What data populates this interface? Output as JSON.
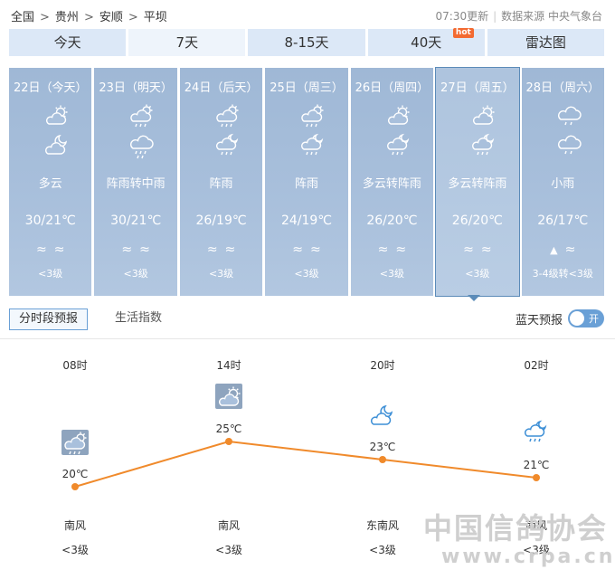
{
  "breadcrumb": {
    "items": [
      "全国",
      "贵州",
      "安顺",
      "平坝"
    ],
    "sep": ">"
  },
  "header": {
    "updated": "07:30更新",
    "source": "数据来源 中央气象台"
  },
  "tabs": [
    {
      "label": "今天"
    },
    {
      "label": "7天",
      "active": true
    },
    {
      "label": "8-15天"
    },
    {
      "label": "40天",
      "badge": "hot"
    },
    {
      "label": "雷达图"
    }
  ],
  "days": [
    {
      "date": "22日（今天）",
      "icon_day": "partly-cloudy-day-icon",
      "icon_night": "partly-cloudy-night-icon",
      "desc": "多云",
      "temp": "30/21℃",
      "wind_icon1": "≈",
      "wind_icon2": "≈",
      "wind_level": "<3级"
    },
    {
      "date": "23日（明天）",
      "icon_day": "shower-icon",
      "icon_night": "rain-icon",
      "desc": "阵雨转中雨",
      "temp": "30/21℃",
      "wind_icon1": "≈",
      "wind_icon2": "≈",
      "wind_level": "<3级"
    },
    {
      "date": "24日（后天）",
      "icon_day": "shower-icon",
      "icon_night": "shower-night-icon",
      "desc": "阵雨",
      "temp": "26/19℃",
      "wind_icon1": "≈",
      "wind_icon2": "≈",
      "wind_level": "<3级"
    },
    {
      "date": "25日（周三）",
      "icon_day": "shower-icon",
      "icon_night": "shower-night-icon",
      "desc": "阵雨",
      "temp": "24/19℃",
      "wind_icon1": "≈",
      "wind_icon2": "≈",
      "wind_level": "<3级"
    },
    {
      "date": "26日（周四）",
      "icon_day": "partly-cloudy-day-icon",
      "icon_night": "shower-night-icon",
      "desc": "多云转阵雨",
      "temp": "26/20℃",
      "wind_icon1": "≈",
      "wind_icon2": "≈",
      "wind_level": "<3级"
    },
    {
      "date": "27日（周五）",
      "icon_day": "partly-cloudy-day-icon",
      "icon_night": "shower-night-icon",
      "desc": "多云转阵雨",
      "temp": "26/20℃",
      "wind_icon1": "≈",
      "wind_icon2": "≈",
      "wind_level": "<3级",
      "selected": true
    },
    {
      "date": "28日（周六）",
      "icon_day": "light-rain-icon",
      "icon_night": "light-rain-icon",
      "desc": "小雨",
      "temp": "26/17℃",
      "wind_icon1": "▲",
      "wind_icon2": "≈",
      "wind_level": "3-4级转<3级"
    }
  ],
  "subtabs": [
    {
      "label": "分时段预报",
      "active": true
    },
    {
      "label": "生活指数"
    }
  ],
  "blue_sky": {
    "label": "蓝天预报",
    "toggle": "开"
  },
  "hourly": [
    {
      "time": "08时",
      "icon": "shower-icon",
      "temp_c": 20,
      "temp_label": "20℃",
      "wind_dir": "南风",
      "wind_level": "<3级"
    },
    {
      "time": "14时",
      "icon": "partly-cloudy-day-icon",
      "temp_c": 25,
      "temp_label": "25℃",
      "wind_dir": "南风",
      "wind_level": "<3级"
    },
    {
      "time": "20时",
      "icon": "partly-cloudy-night-icon",
      "temp_c": 23,
      "temp_label": "23℃",
      "wind_dir": "东南风",
      "wind_level": "<3级"
    },
    {
      "time": "02时",
      "icon": "shower-night-icon",
      "temp_c": 21,
      "temp_label": "21℃",
      "wind_dir": "南风",
      "wind_level": "<3级"
    }
  ],
  "colors": {
    "line": "#f08a2b",
    "tab_bg": "#dce8f7",
    "card_bg": "#a9c0dc",
    "accent": "#6aa0d6"
  },
  "watermark": {
    "line1": "中国信鸽协会",
    "line2": "www.crpa.cn"
  }
}
